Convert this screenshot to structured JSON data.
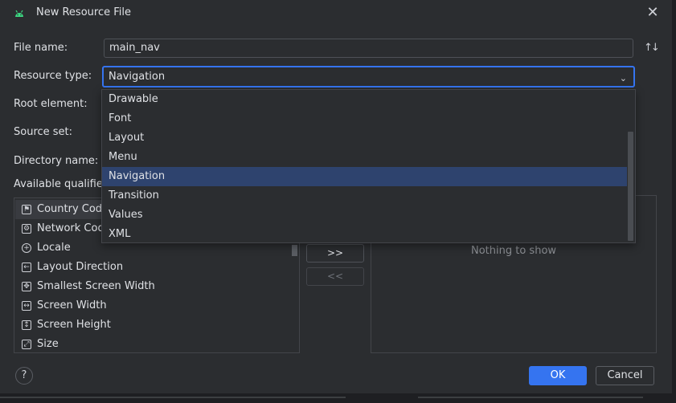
{
  "dialog": {
    "title": "New Resource File",
    "android_icon": "android-icon",
    "close_icon": "close-icon"
  },
  "form": {
    "file_name_label": "File name:",
    "file_name_value": "main_nav",
    "resource_type_label": "Resource type:",
    "resource_type_value": "Navigation",
    "root_element_label": "Root element:",
    "source_set_label": "Source set:",
    "directory_name_label": "Directory name:",
    "available_qualifiers_label": "Available qualifiers:"
  },
  "dropdown": {
    "options": [
      "Drawable",
      "Font",
      "Layout",
      "Menu",
      "Navigation",
      "Transition",
      "Values",
      "XML"
    ],
    "selected": "Navigation"
  },
  "qualifiers": [
    {
      "label": "Country Code",
      "icon": "country-code-icon"
    },
    {
      "label": "Network Code",
      "icon": "network-code-icon"
    },
    {
      "label": "Locale",
      "icon": "globe-icon"
    },
    {
      "label": "Layout Direction",
      "icon": "layout-direction-icon"
    },
    {
      "label": "Smallest Screen Width",
      "icon": "smallest-width-icon"
    },
    {
      "label": "Screen Width",
      "icon": "screen-width-icon"
    },
    {
      "label": "Screen Height",
      "icon": "screen-height-icon"
    },
    {
      "label": "Size",
      "icon": "size-icon"
    }
  ],
  "transfer": {
    "add_label": ">>",
    "remove_label": "<<"
  },
  "chosen": {
    "empty_text": "Nothing to show"
  },
  "footer": {
    "help_label": "?",
    "ok_label": "OK",
    "cancel_label": "Cancel"
  },
  "colors": {
    "accent": "#3574f0",
    "selection": "#2e436e",
    "background": "#2b2d30"
  }
}
